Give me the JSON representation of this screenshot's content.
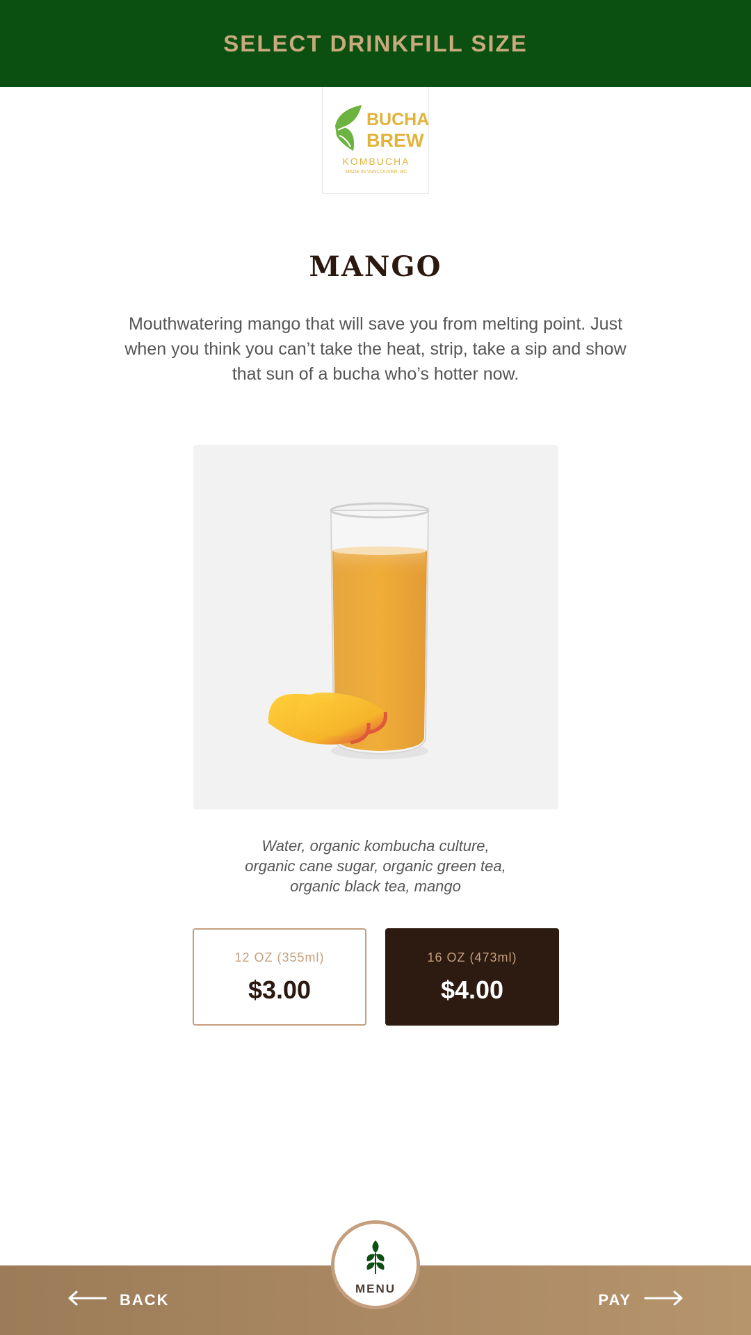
{
  "header": {
    "title": "SELECT DRINKFILL SIZE"
  },
  "logo": {
    "line1": "BUCHA",
    "line2": "BREW",
    "line3": "KOMBUCHA",
    "line4": "MADE IN VANCOUVER, BC"
  },
  "product": {
    "name": "MANGO",
    "description": "Mouthwatering mango that will save you from melting point. Just when you think you can’t take the heat, strip, take a sip and show that sun of a bucha who’s hotter now.",
    "ingredients": [
      "Water, organic kombucha culture,",
      "organic cane sugar, organic green tea,",
      "organic black tea, mango"
    ]
  },
  "sizes": [
    {
      "label": "12 OZ (355ml)",
      "price": "$3.00",
      "selected": false
    },
    {
      "label": "16 OZ (473ml)",
      "price": "$4.00",
      "selected": true
    }
  ],
  "footer": {
    "back_label": "BACK",
    "menu_label": "MENU",
    "pay_label": "PAY"
  },
  "icons": {
    "back": "arrow-left-icon",
    "pay": "arrow-right-icon",
    "menu": "leaf-icon"
  },
  "colors": {
    "header_bg": "#0b5011",
    "accent": "#c59f7d",
    "dark": "#2d1a10",
    "footer": "#a98963"
  }
}
